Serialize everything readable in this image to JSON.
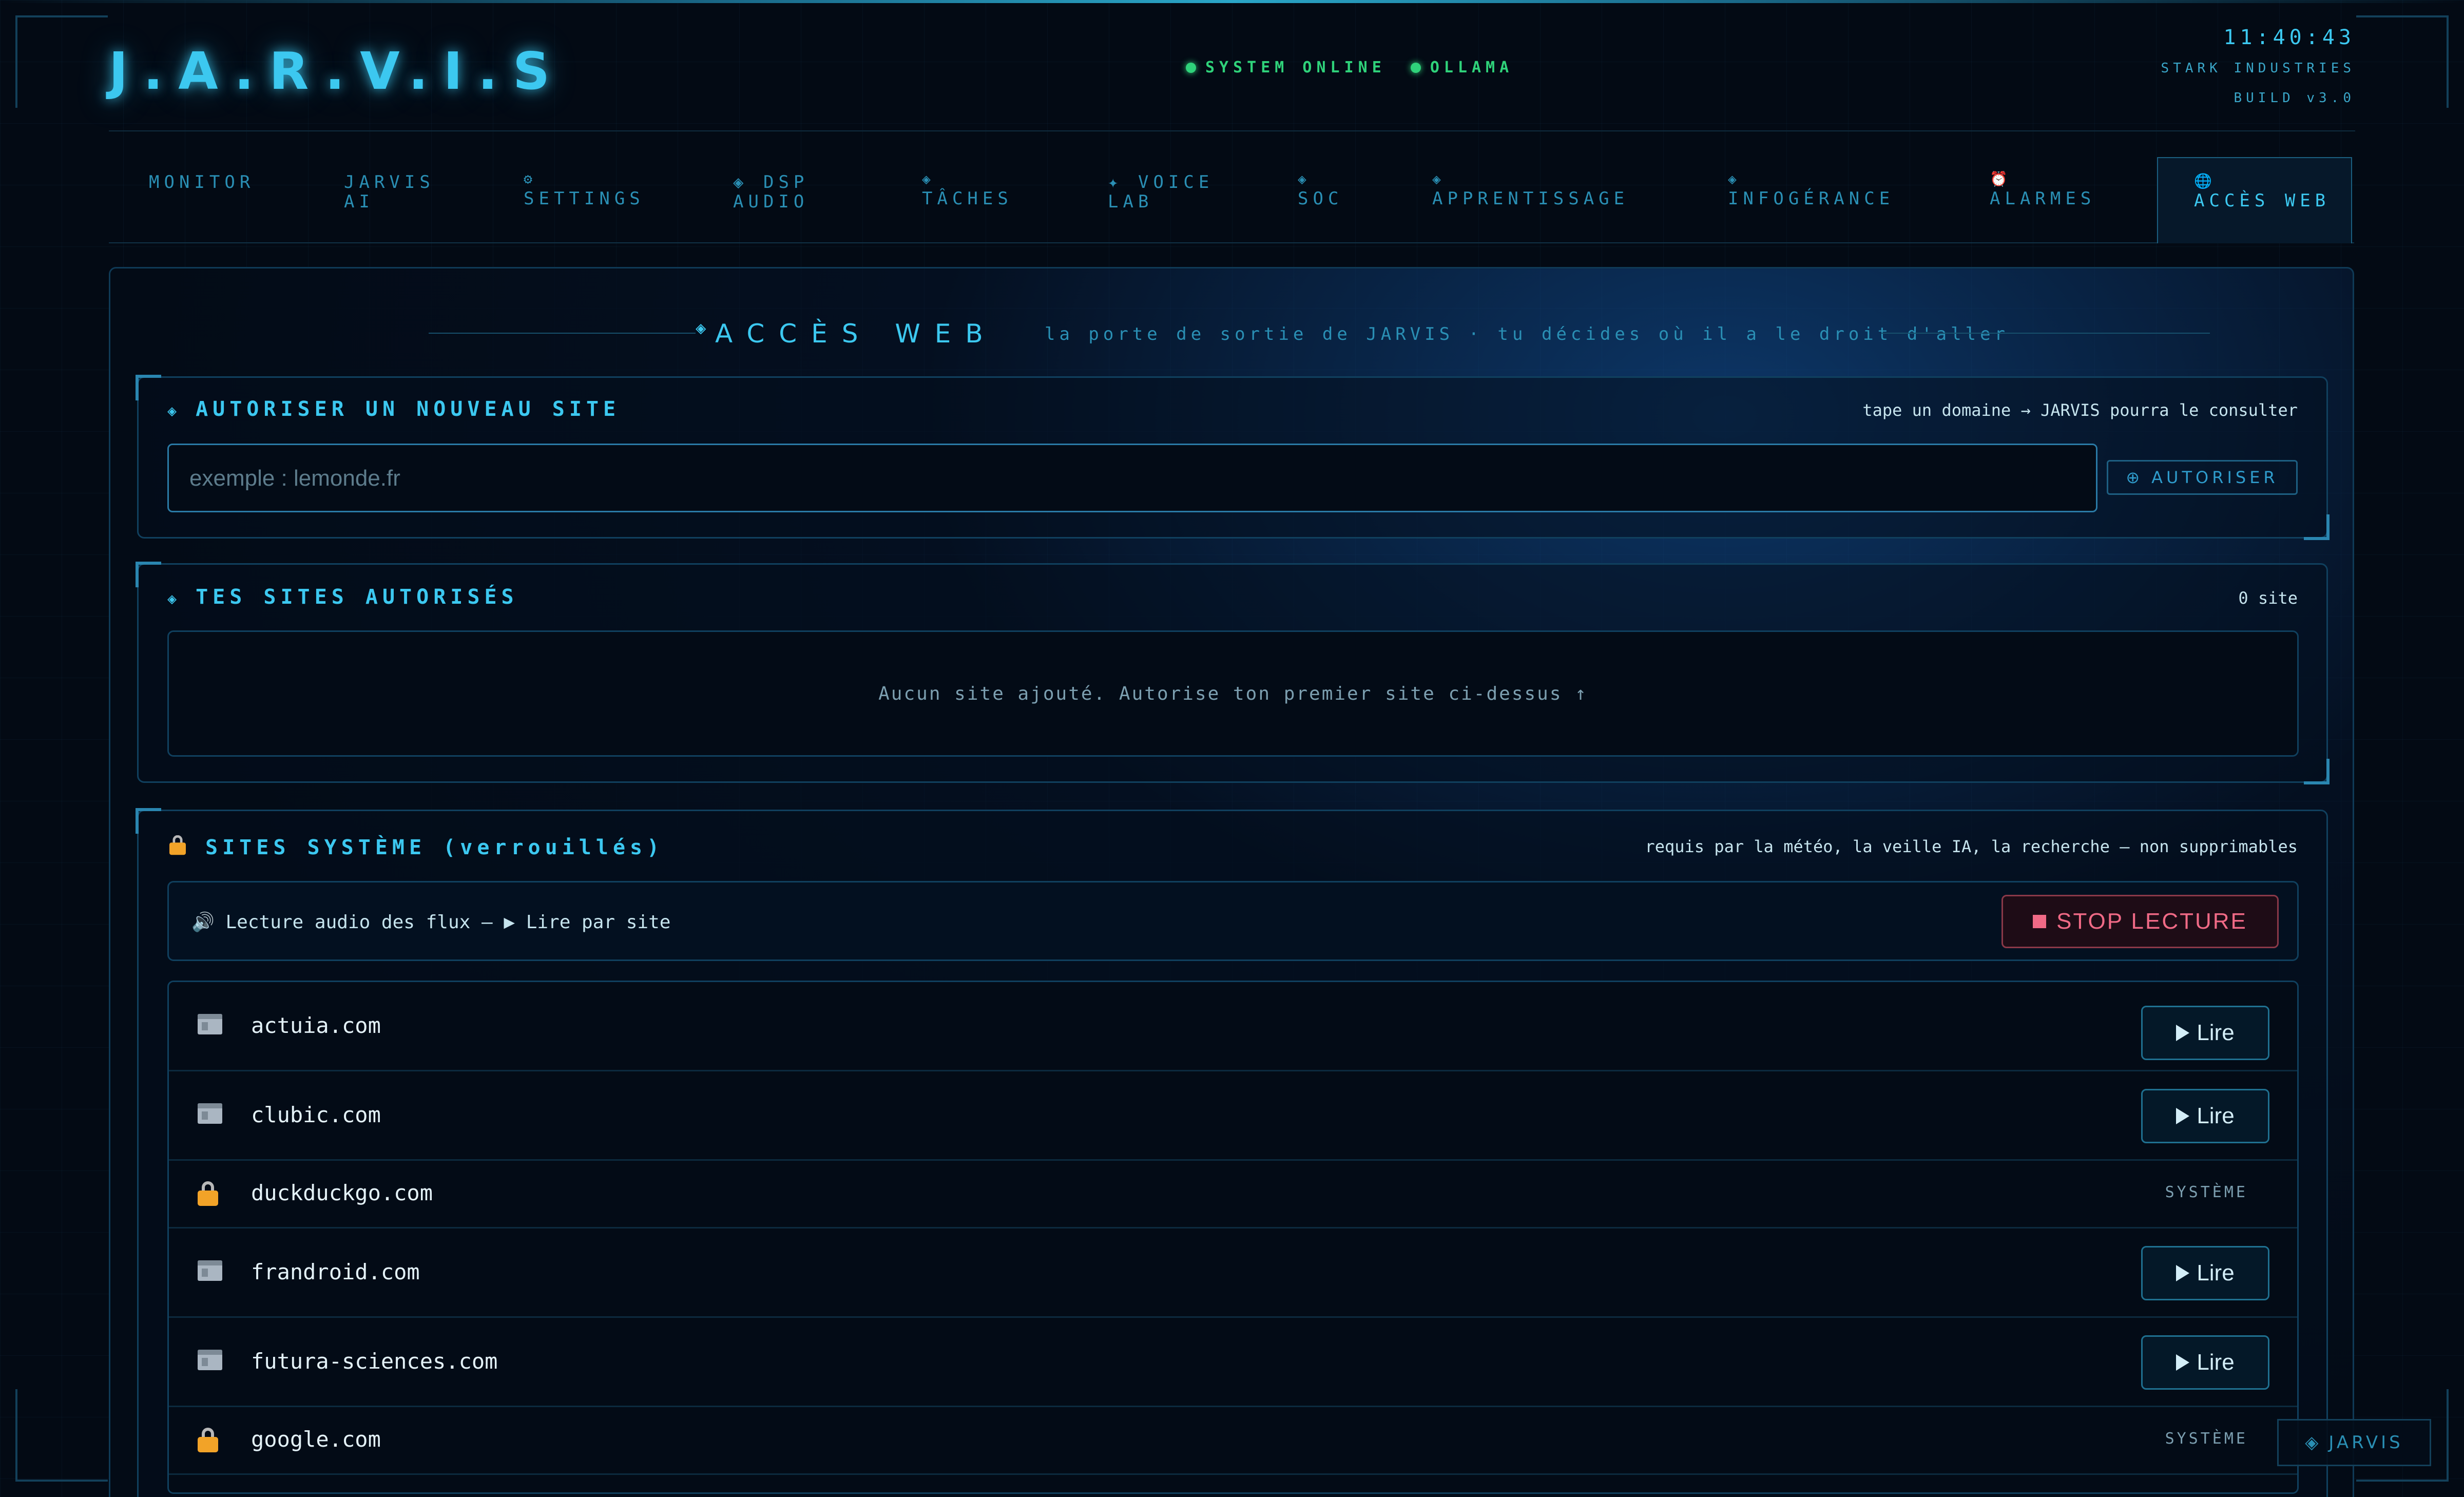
{
  "header": {
    "logo": "J.A.R.V.I.S",
    "status": [
      {
        "label": "SYSTEM ONLINE",
        "color": "#2fd27a"
      },
      {
        "label": "OLLAMA",
        "color": "#2fd27a"
      }
    ],
    "clock": "11:40:43",
    "company": "STARK INDUSTRIES",
    "build": "BUILD v3.0"
  },
  "tabs": [
    {
      "icon": "",
      "label": "MONITOR"
    },
    {
      "icon": "",
      "label": "JARVIS AI"
    },
    {
      "icon": "⚙",
      "label": "SETTINGS"
    },
    {
      "icon": "◈",
      "label": "DSP AUDIO"
    },
    {
      "icon": "◈",
      "label": "TÂCHES"
    },
    {
      "icon": "✦",
      "label": "VOICE LAB"
    },
    {
      "icon": "◈",
      "label": "SOC"
    },
    {
      "icon": "◈",
      "label": "APPRENTISSAGE"
    },
    {
      "icon": "◈",
      "label": "INFOGÉRANCE"
    },
    {
      "icon": "⏰",
      "label": "ALARMES"
    },
    {
      "icon": "🌐",
      "label": "ACCÈS WEB",
      "active": true
    }
  ],
  "page": {
    "title": "ACCÈS WEB",
    "subtitle": "la porte de sortie de JARVIS · tu décides où il a le droit d'aller"
  },
  "authorize": {
    "title": "AUTORISER UN NOUVEAU SITE",
    "hint": "tape un domaine → JARVIS pourra le consulter",
    "placeholder": "exemple : lemonde.fr",
    "button": "AUTORISER"
  },
  "authorized": {
    "title": "TES SITES AUTORISÉS",
    "count": "0 site",
    "empty": "Aucun site ajouté. Autorise ton premier site ci-dessus ↑"
  },
  "system_sites": {
    "title": "SITES SYSTÈME (verrouillés)",
    "hint": "requis par la météo, la veille IA, la recherche — non supprimables",
    "audio_label": "🔊 Lecture audio des flux — ▶ Lire par site",
    "stop_button": "STOP LECTURE",
    "read_label": "Lire",
    "system_label": "SYSTÈME",
    "sites": [
      {
        "domain": "actuia.com",
        "icon": "page-icon",
        "action": "read"
      },
      {
        "domain": "clubic.com",
        "icon": "page-icon",
        "action": "read"
      },
      {
        "domain": "duckduckgo.com",
        "icon": "lock-icon",
        "action": "system"
      },
      {
        "domain": "frandroid.com",
        "icon": "page-icon",
        "action": "read"
      },
      {
        "domain": "futura-sciences.com",
        "icon": "page-icon",
        "action": "read"
      },
      {
        "domain": "google.com",
        "icon": "lock-icon",
        "action": "system"
      }
    ]
  },
  "badge": {
    "label": "JARVIS"
  },
  "colors": {
    "accent": "#3cc8f0",
    "online": "#2fd27a",
    "stop": "#f06a86",
    "lock": "#f2a328"
  }
}
